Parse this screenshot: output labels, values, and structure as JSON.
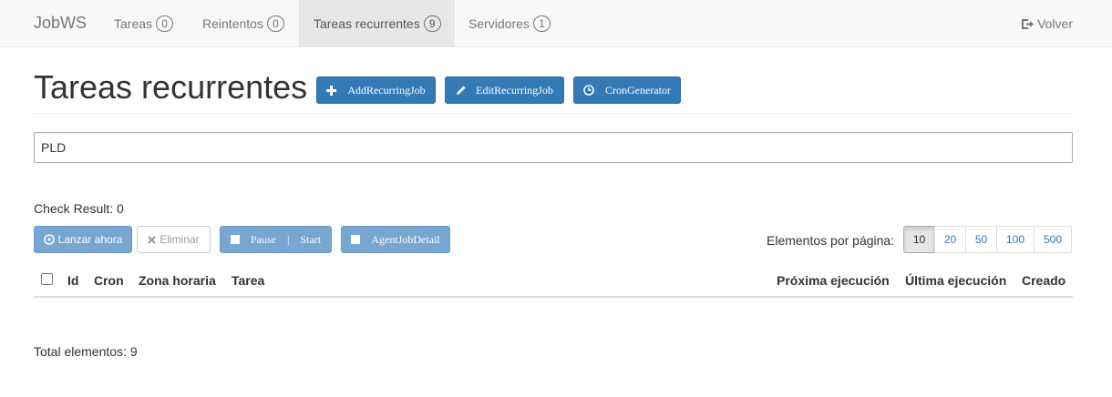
{
  "navbar": {
    "brand": "JobWS",
    "items": [
      {
        "label": "Tareas",
        "badge": "0"
      },
      {
        "label": "Reintentos",
        "badge": "0"
      },
      {
        "label": "Tareas recurrentes",
        "badge": "9"
      },
      {
        "label": "Servidores",
        "badge": "1"
      }
    ],
    "right_label": "Volver"
  },
  "page": {
    "title": "Tareas recurrentes",
    "header_buttons": {
      "add": "AddRecurringJob",
      "edit": "EditRecurringJob",
      "cron": "CronGenerator"
    }
  },
  "search": {
    "value": "PLD"
  },
  "check_result": "Check Result: 0",
  "actions": {
    "launch": "Lanzar ahora",
    "delete": "Eliminar",
    "pause_start": "Pause    |    Start",
    "agent": "AgentJobDetail"
  },
  "pagination": {
    "label": "Elementos por página:",
    "sizes": [
      "10",
      "20",
      "50",
      "100",
      "500"
    ],
    "selected": "10"
  },
  "table": {
    "headers": {
      "id": "Id",
      "cron": "Cron",
      "timezone": "Zona horaria",
      "task": "Tarea",
      "next": "Próxima ejecución",
      "last": "Última ejecución",
      "created": "Creado"
    }
  },
  "total": "Total elementos: 9",
  "colors": {
    "primary": "#337ab7",
    "navbar_bg": "#f8f8f8",
    "active_nav_bg": "#e7e7e7"
  }
}
